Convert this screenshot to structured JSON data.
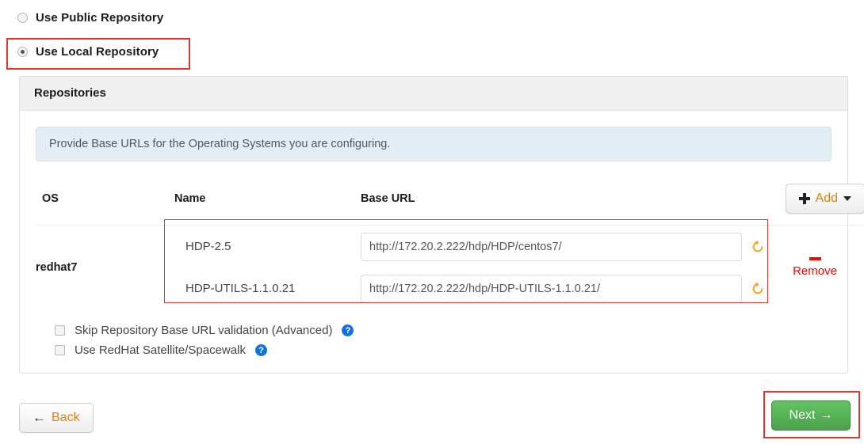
{
  "repository_mode": {
    "public": {
      "label": "Use Public Repository",
      "selected": false
    },
    "local": {
      "label": "Use Local Repository",
      "selected": true
    }
  },
  "panel": {
    "title": "Repositories",
    "info_message": "Provide Base URLs for the Operating Systems you are configuring."
  },
  "toolbar": {
    "add_label": "Add",
    "add_icon": "plus-icon",
    "caret_icon": "chevron-down-icon"
  },
  "table": {
    "headers": {
      "os": "OS",
      "name": "Name",
      "base_url": "Base URL"
    },
    "rows": [
      {
        "os": "redhat7",
        "repos": [
          {
            "name": "HDP-2.5",
            "base_url": "http://172.20.2.222/hdp/HDP/centos7/",
            "undo_icon": "undo-icon"
          },
          {
            "name": "HDP-UTILS-1.1.0.21",
            "base_url": "http://172.20.2.222/hdp/HDP-UTILS-1.1.0.21/",
            "undo_icon": "undo-icon"
          }
        ],
        "remove_label": "Remove",
        "remove_icon": "minus-icon"
      }
    ]
  },
  "options": [
    {
      "label": "Skip Repository Base URL validation (Advanced)",
      "checked": false,
      "help_icon": "help-icon",
      "help_glyph": "?"
    },
    {
      "label": "Use RedHat Satellite/Spacewalk",
      "checked": false,
      "help_icon": "help-icon",
      "help_glyph": "?"
    }
  ],
  "footer": {
    "back_label": "Back",
    "back_arrow": "←",
    "next_label": "Next",
    "next_arrow": "→"
  },
  "colors": {
    "annotation_red": "#e8352b",
    "remove_red": "#fe0000",
    "undo_orange": "#f5a623",
    "next_green": "#62c462",
    "help_blue": "#1172e8",
    "link_orange": "#d58512",
    "info_bg": "#e2eef3",
    "panel_header_bg": "#f0f0f0"
  }
}
